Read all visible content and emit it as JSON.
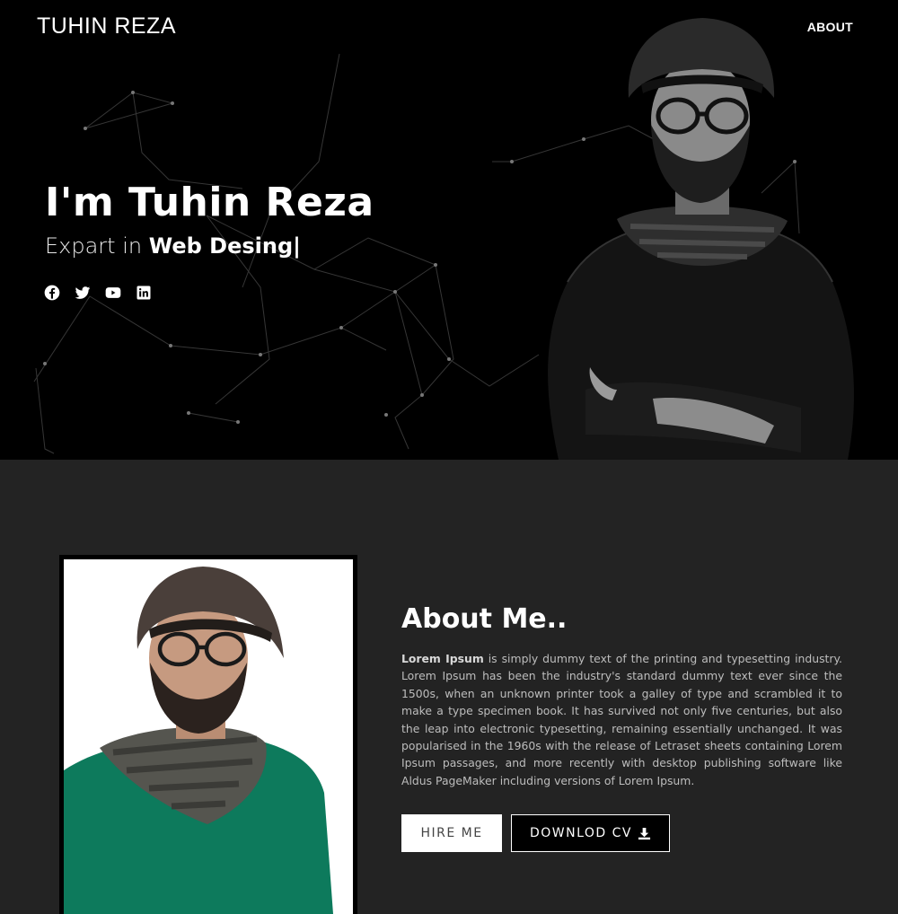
{
  "nav": {
    "brand": "TUHIN REZA",
    "about": "ABOUT"
  },
  "hero": {
    "title": "I'm Tuhin Reza",
    "subtitle_prefix": "Expart in ",
    "subtitle_strong": "Web Desing|",
    "social": [
      "facebook-icon",
      "twitter-icon",
      "youtube-icon",
      "linkedin-icon"
    ]
  },
  "about": {
    "title": "About Me..",
    "lead": "Lorem Ipsum",
    "body": " is simply dummy text of the printing and typesetting industry. Lorem Ipsum has been the industry's standard dummy text ever since the 1500s, when an unknown printer took a galley of type and scrambled it to make a type specimen book. It has survived not only five centuries, but also the leap into electronic typesetting, remaining essentially unchanged. It was popularised in the 1960s with the release of Letraset sheets containing Lorem Ipsum passages, and more recently with desktop publishing software like Aldus PageMaker including versions of Lorem Ipsum.",
    "hire_label": "HIRE ME",
    "cv_label": "DOWNLOD CV"
  },
  "colors": {
    "hero_bg": "#000000",
    "section_bg": "#232323",
    "accent": "#ffffff",
    "shirt": "#0d7a5c"
  }
}
